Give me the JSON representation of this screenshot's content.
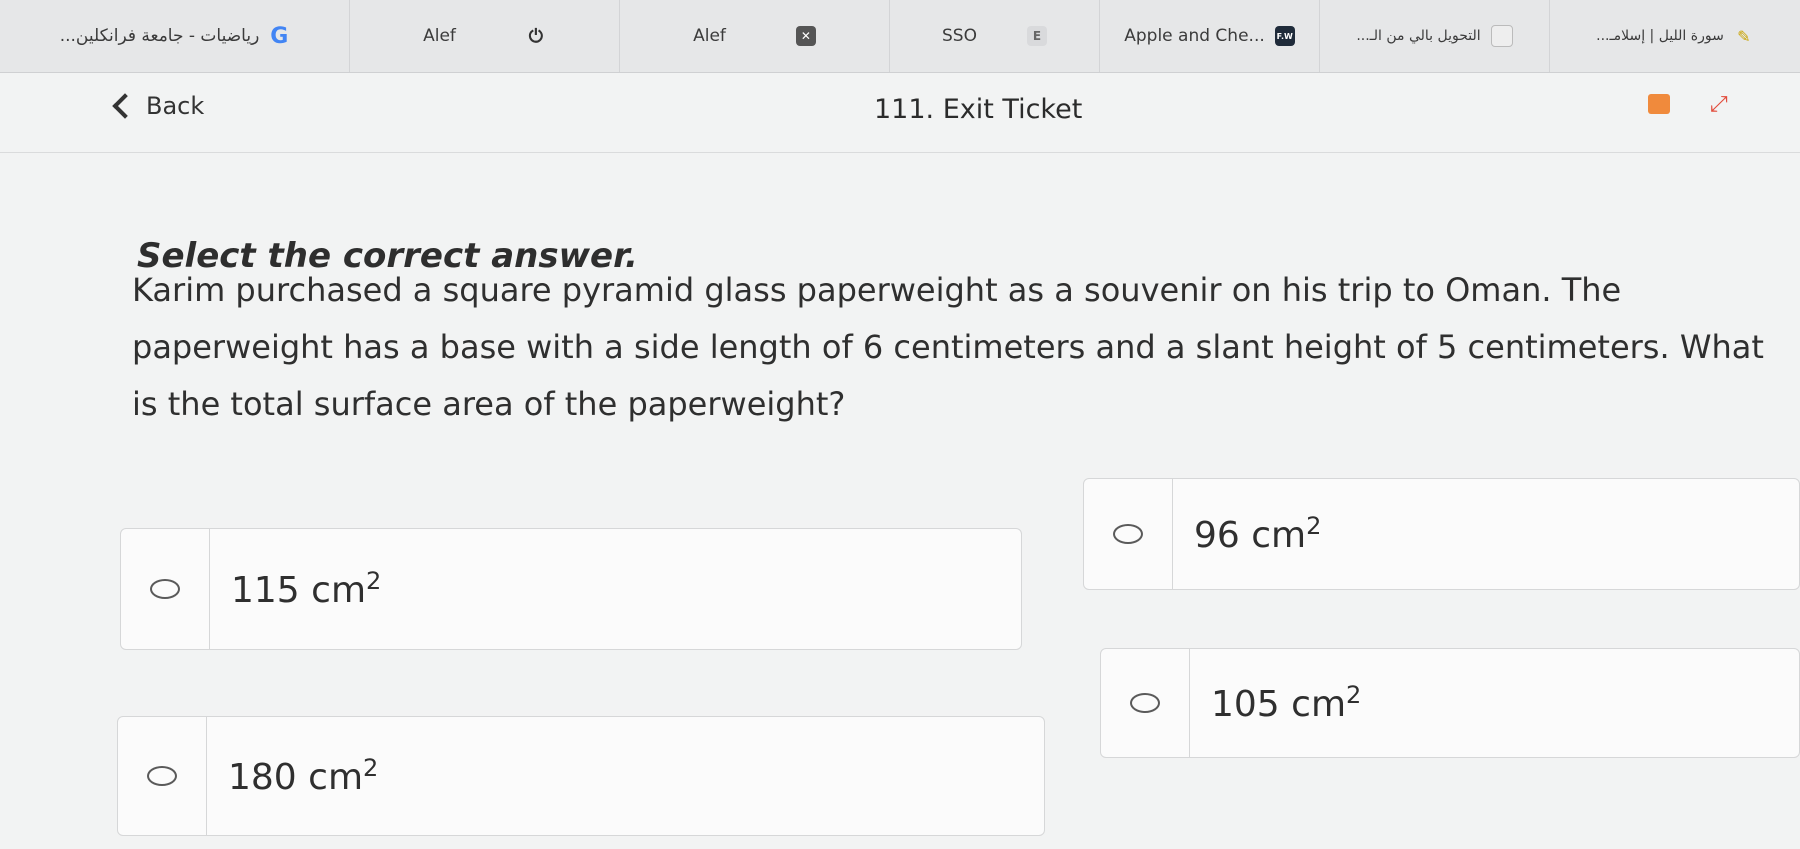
{
  "tabs": [
    {
      "label": "...رياضيات - جامعة فرانكلين",
      "icon": "google-g-icon",
      "glyph": "G"
    },
    {
      "label": "Alef",
      "icon": "power-icon",
      "glyph": "⏻"
    },
    {
      "label": "Alef",
      "icon": "close-icon",
      "glyph": "✕"
    },
    {
      "label": "SSO",
      "icon": "e-badge-icon",
      "glyph": "E"
    },
    {
      "label": "Apple and Che...",
      "icon": "fw-badge-icon",
      "glyph": "F.W"
    },
    {
      "label": "...التحويل بالي من الـ",
      "icon": "blank-page-icon",
      "glyph": ""
    },
    {
      "label": "...سورة الليل | إسلامـ",
      "icon": "bookmark-icon",
      "glyph": "✎"
    }
  ],
  "header": {
    "back_label": "Back",
    "title": "111. Exit Ticket"
  },
  "content": {
    "instruction": "Select the correct answer.",
    "question": "Karim purchased a square pyramid glass paperweight as a souvenir on his trip to Oman. The paperweight has a base with a side length of 6 centimeters and a slant height of 5 centimeters. What is the total surface area of the paperweight?"
  },
  "options": [
    {
      "id": "a",
      "value": "115",
      "unit": "cm",
      "exp": "2",
      "selected": false
    },
    {
      "id": "b",
      "value": "96",
      "unit": "cm",
      "exp": "2",
      "selected": false
    },
    {
      "id": "c",
      "value": "180",
      "unit": "cm",
      "exp": "2",
      "selected": false
    },
    {
      "id": "d",
      "value": "105",
      "unit": "cm",
      "exp": "2",
      "selected": false
    }
  ],
  "colors": {
    "background": "#f2f3f3",
    "text": "#2f2f2f",
    "tabbar": "#e6e7e8",
    "accent_orange": "#f08a3c"
  }
}
